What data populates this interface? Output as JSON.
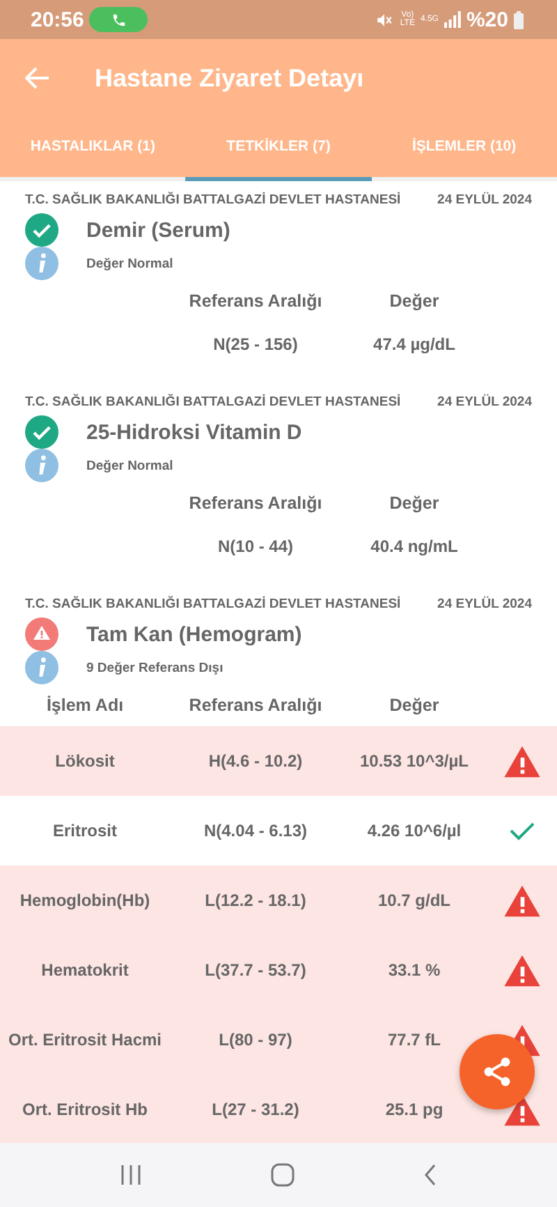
{
  "status_bar": {
    "time": "20:56",
    "volte": "Vo)",
    "lte": "LTE",
    "network": "4.5G",
    "battery": "%20"
  },
  "app_bar": {
    "title": "Hastane Ziyaret Detayı"
  },
  "tabs": [
    {
      "label": "HASTALIKLAR (1)",
      "selected": false
    },
    {
      "label": "TETKİKLER (7)",
      "selected": true
    },
    {
      "label": "İŞLEMLER (10)",
      "selected": false
    }
  ],
  "tests": [
    {
      "hospital": "T.C. SAĞLIK BAKANLIĞI BATTALGAZİ DEVLET HASTANESİ",
      "date": "24 EYLÜL 2024",
      "name": "Demir (Serum)",
      "abnormal": false,
      "note": "Değer Normal",
      "columns": [
        "Referans Aralığı",
        "Değer"
      ],
      "rows": [
        {
          "range": "N(25 - 156)",
          "value": "47.4 µg/dL"
        }
      ]
    },
    {
      "hospital": "T.C. SAĞLIK BAKANLIĞI BATTALGAZİ DEVLET HASTANESİ",
      "date": "24 EYLÜL 2024",
      "name": "25-Hidroksi Vitamin D",
      "abnormal": false,
      "note": "Değer Normal",
      "columns": [
        "Referans Aralığı",
        "Değer"
      ],
      "rows": [
        {
          "range": "N(10 - 44)",
          "value": "40.4 ng/mL"
        }
      ]
    },
    {
      "hospital": "T.C. SAĞLIK BAKANLIĞI BATTALGAZİ DEVLET HASTANESİ",
      "date": "24 EYLÜL 2024",
      "name": "Tam Kan (Hemogram)",
      "abnormal": true,
      "note": "9 Değer Referans Dışı",
      "columns": [
        "İşlem Adı",
        "Referans Aralığı",
        "Değer"
      ],
      "rows": [
        {
          "name": "Lökosit",
          "range": "H(4.6 - 10.2)",
          "value": "10.53 10^3/µL",
          "abnormal": true
        },
        {
          "name": "Eritrosit",
          "range": "N(4.04 - 6.13)",
          "value": "4.26 10^6/µl",
          "abnormal": false
        },
        {
          "name": "Hemoglobin(Hb)",
          "range": "L(12.2 - 18.1)",
          "value": "10.7 g/dL",
          "abnormal": true
        },
        {
          "name": "Hematokrit",
          "range": "L(37.7 - 53.7)",
          "value": "33.1 %",
          "abnormal": true
        },
        {
          "name": "Ort. Eritrosit Hacmi",
          "range": "L(80 - 97)",
          "value": "77.7 fL",
          "abnormal": true
        },
        {
          "name": "Ort. Eritrosit Hb",
          "range": "L(27 - 31.2)",
          "value": "25.1 pg",
          "abnormal": true
        }
      ]
    }
  ]
}
